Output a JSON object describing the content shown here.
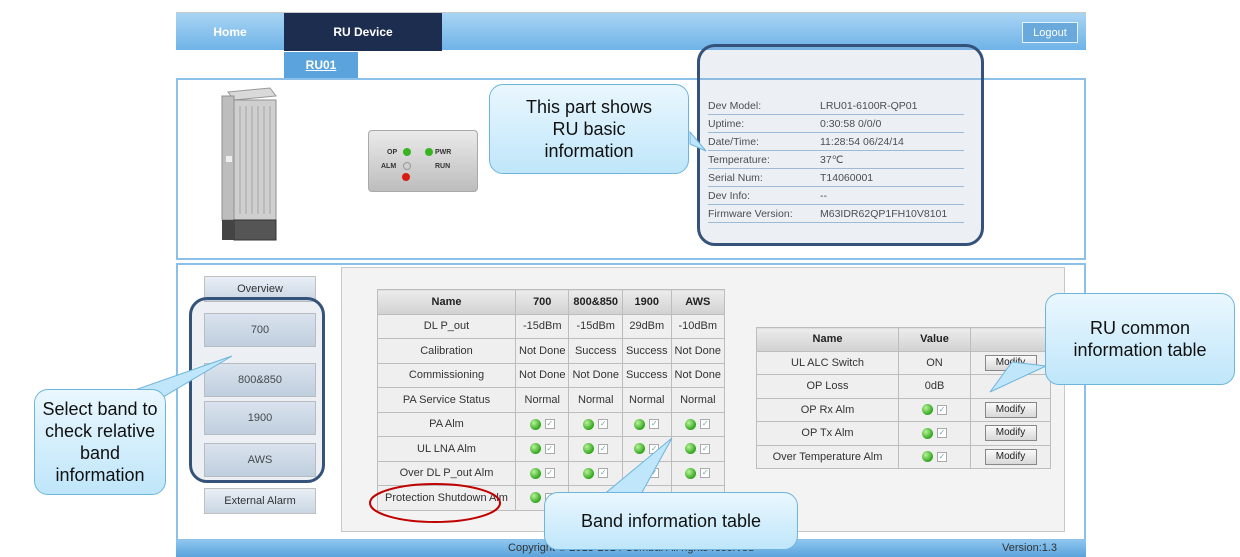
{
  "nav": {
    "home_label": "Home",
    "ru_device_label": "RU Device",
    "logout_label": "Logout",
    "subtab_label": "RU01"
  },
  "led_panel": {
    "op": "OP",
    "pwr": "PWR",
    "alm": "ALM",
    "run": "RUN"
  },
  "basic_info": [
    {
      "label": "Dev Model:",
      "value": "LRU01-6100R-QP01"
    },
    {
      "label": "Uptime:",
      "value": "0:30:58 0/0/0"
    },
    {
      "label": "Date/Time:",
      "value": "11:28:54 06/24/14"
    },
    {
      "label": "Temperature:",
      "value": "37℃"
    },
    {
      "label": "Serial Num:",
      "value": "T14060001"
    },
    {
      "label": "Dev Info:",
      "value": "--"
    },
    {
      "label": "Firmware Version:",
      "value": "M63IDR62QP1FH10V8101"
    }
  ],
  "side_menu": [
    "Overview",
    "700",
    "800&850",
    "1900",
    "AWS",
    "External Alarm"
  ],
  "band_table": {
    "headers": [
      "Name",
      "700",
      "800&850",
      "1900",
      "AWS"
    ],
    "text_rows": [
      {
        "name": "DL P_out",
        "values": [
          "-15dBm",
          "-15dBm",
          "29dBm",
          "-10dBm"
        ]
      },
      {
        "name": "Calibration",
        "values": [
          "Not Done",
          "Success",
          "Success",
          "Not Done"
        ]
      },
      {
        "name": "Commissioning",
        "values": [
          "Not Done",
          "Not Done",
          "Success",
          "Not Done"
        ]
      },
      {
        "name": "PA Service Status",
        "values": [
          "Normal",
          "Normal",
          "Normal",
          "Normal"
        ]
      }
    ],
    "alarm_rows": [
      {
        "name": "PA Alm",
        "states": [
          "green",
          "green",
          "green",
          "green"
        ]
      },
      {
        "name": "UL LNA Alm",
        "states": [
          "green",
          "green",
          "green",
          "green"
        ]
      },
      {
        "name": "Over DL P_out Alm",
        "states": [
          "green",
          "green",
          "red",
          "green"
        ]
      },
      {
        "name": "Protection Shutdown Alm",
        "states": [
          "green",
          "green",
          "green",
          "green"
        ]
      }
    ]
  },
  "common_table": {
    "headers": [
      "Name",
      "Value",
      ""
    ],
    "rows": [
      {
        "name": "UL ALC Switch",
        "value": "ON",
        "type": "text",
        "button": "Modify"
      },
      {
        "name": "OP Loss",
        "value": "0dB",
        "type": "text",
        "button": ""
      },
      {
        "name": "OP Rx Alm",
        "value": "",
        "type": "led",
        "state": "green",
        "button": "Modify"
      },
      {
        "name": "OP Tx Alm",
        "value": "",
        "type": "led",
        "state": "green",
        "button": "Modify"
      },
      {
        "name": "Over Temperature Alm",
        "value": "",
        "type": "led",
        "state": "green",
        "button": "Modify"
      }
    ]
  },
  "footer": {
    "copyright": "Copyright © 2013-2014 Comba. All rights reserved",
    "version": "Version:1.3"
  },
  "annotations": {
    "basic_info": "This part shows RU basic information",
    "common_table": "RU common information table",
    "select_band": "Select band to check relative band information",
    "band_table": "Band information table"
  },
  "colors": {
    "nav_gradient_top": "#a8d4f3",
    "nav_active": "#1c2d4f",
    "panel_border": "#8bc0e9",
    "led_green": "#2fa51b",
    "led_red": "#d21a12",
    "callout_fill": "#bfe6fa",
    "outline": "#34527a",
    "highlight_ellipse": "#c00000"
  },
  "icons": [
    "led-green-icon",
    "led-red-icon",
    "checkbox-icon",
    "ru-device-image"
  ]
}
